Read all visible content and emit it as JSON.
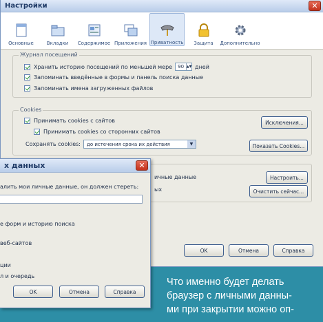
{
  "window": {
    "title": "Настройки",
    "close_label": "✕"
  },
  "toolbar": {
    "tabs": [
      {
        "label": "Основные",
        "icon": "window-icon"
      },
      {
        "label": "Вкладки",
        "icon": "folder-icon"
      },
      {
        "label": "Содержимое",
        "icon": "content-icon"
      },
      {
        "label": "Приложения",
        "icon": "applications-icon"
      },
      {
        "label": "Приватность",
        "icon": "privacy-mask-icon"
      },
      {
        "label": "Защита",
        "icon": "lock-icon"
      },
      {
        "label": "Дополнительно",
        "icon": "gear-icon"
      }
    ],
    "active": "Приватность"
  },
  "history": {
    "title": "Журнал посещений",
    "keep_history_label": "Хранить историю посещений по меньшей мере",
    "days_value": "90",
    "days_unit": "дней",
    "remember_forms_label": "Запоминать введённые в формы и панель поиска данные",
    "remember_downloads_label": "Запоминать имена загруженных файлов"
  },
  "cookies": {
    "title": "Cookies",
    "accept_label": "Принимать cookies с сайтов",
    "accept_third_party_label": "Принимать cookies со сторонних сайтов",
    "keep_label": "Сохранять cookies:",
    "keep_value": "до истечения срока их действия",
    "exceptions_button": "Исключения...",
    "show_cookies_button": "Показать Cookies..."
  },
  "private_data": {
    "text_1": "ичные данные",
    "text_2": "ых",
    "settings_button": "Настроить...",
    "clear_now_button": "Очистить сейчас..."
  },
  "footer": {
    "ok": "OK",
    "cancel": "Отмена",
    "help": "Справка"
  },
  "dialog": {
    "title": "х данных",
    "close_label": "✕",
    "intro": "алить мои личные данные, он должен стереть:",
    "line_forms": "е форм и историю поиска",
    "line_websites": "веб-сайтов",
    "line_sessions": "ции",
    "line_queue": "л и очередь",
    "ok": "OK",
    "cancel": "Отмена",
    "help": "Справка"
  },
  "caption": {
    "line1": "Что именно будет делать",
    "line2": "браузер с личными данны-",
    "line3": "ми при закрытии можно оп-"
  },
  "colors": {
    "background": "#2d8ea6",
    "window": "#ecebe4",
    "close": "#c4321d",
    "check": "#2f9a3a"
  }
}
